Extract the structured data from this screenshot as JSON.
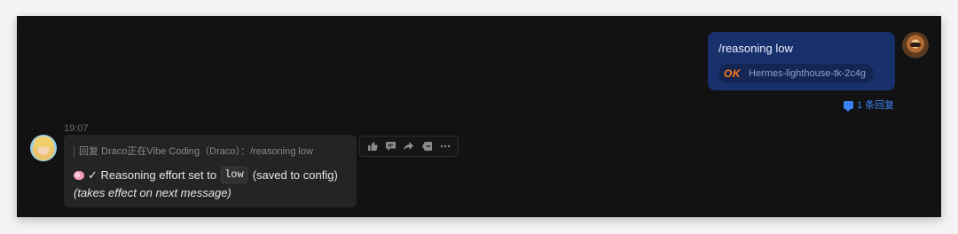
{
  "outgoing": {
    "text": "/reasoning low",
    "badge": "OK",
    "session_label": "Hermes-lighthouse-tk-2c4g",
    "reply_count": "1 条回复"
  },
  "incoming": {
    "timestamp": "19:07",
    "quote": "回复 Draco正在Vibe Coding（Draco）：/reasoning low",
    "line1_prefix": "✓ Reasoning effort set to",
    "line1_code": "low",
    "line1_suffix": "(saved to config)",
    "line2": "(takes effect on next message)"
  },
  "toolbar": {
    "icons": [
      "thumbs-up-icon",
      "comment-icon",
      "forward-icon",
      "bookmark-icon",
      "more-icon"
    ]
  },
  "colors": {
    "outgoing_bubble": "#18306b",
    "badge": "#ff7a1a",
    "reply_link": "#3b82f6",
    "background": "#121212"
  }
}
